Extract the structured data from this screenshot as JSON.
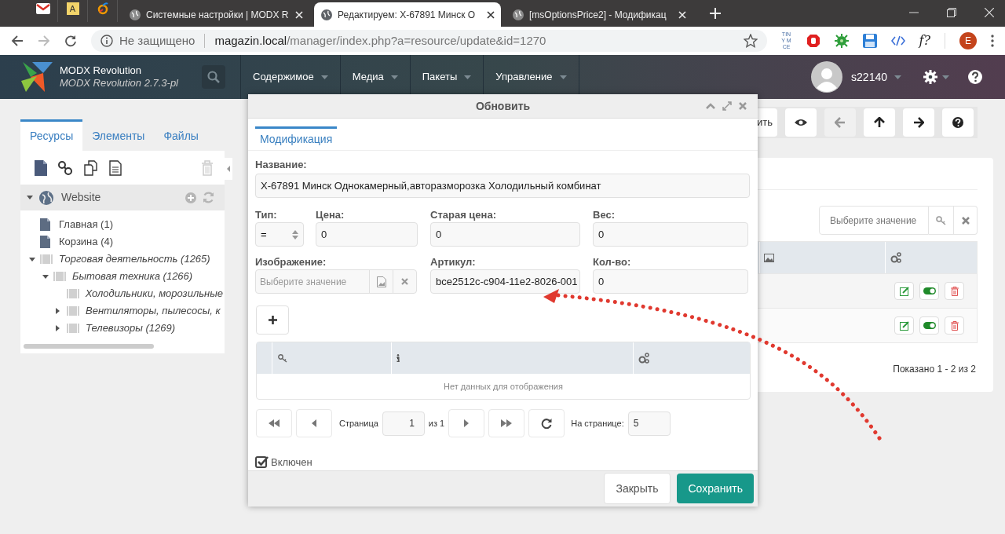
{
  "browser": {
    "pinned_tabs": [
      {
        "kind": "mail"
      },
      {
        "kind": "letter",
        "label": "A"
      },
      {
        "kind": "swirl"
      }
    ],
    "tabs": [
      {
        "title": "Системные настройки | MODX R",
        "selected": false
      },
      {
        "title": "Редактируем: X-67891 Минск О",
        "selected": true
      },
      {
        "title": "[msOptionsPrice2] - Модификац",
        "selected": false
      }
    ],
    "security": "Не защищено",
    "url_host": "magazin.local",
    "url_path": "/manager/index.php?a=resource/update&id=1270",
    "extensions": [
      {
        "kind": "tinymce",
        "label": "TINY MCE"
      },
      {
        "kind": "stop"
      },
      {
        "kind": "bug"
      },
      {
        "kind": "save"
      },
      {
        "kind": "code"
      },
      {
        "kind": "text",
        "label": "f?"
      }
    ],
    "profile": "E"
  },
  "header": {
    "brand": "MODX Revolution",
    "version": "MODX Revolution 2.7.3-pl",
    "menu": [
      "Содержимое",
      "Медиа",
      "Пакеты",
      "Управление"
    ],
    "user": "s22140"
  },
  "sidebar": {
    "tabs": [
      {
        "label": "Ресурсы",
        "selected": true
      },
      {
        "label": "Элементы",
        "selected": false
      },
      {
        "label": "Файлы",
        "selected": false
      }
    ],
    "root": "Website",
    "tree": [
      {
        "label": "Главная (1)",
        "kind": "document"
      },
      {
        "label": "Корзина (4)",
        "kind": "document"
      },
      {
        "label": "Торговая деятельность (1265)",
        "kind": "category",
        "expanded": true,
        "children": [
          {
            "label": "Бытовая техника (1266)",
            "kind": "category",
            "expanded": true,
            "children": [
              {
                "label": "Холодильники, морозильные",
                "kind": "category"
              },
              {
                "label": "Вентиляторы, пылесосы, к",
                "kind": "category",
                "expanded": false
              },
              {
                "label": "Телевизоры (1269)",
                "kind": "category",
                "expanded": false
              }
            ]
          }
        ]
      }
    ]
  },
  "toolbar": [
    {
      "kind": "text",
      "label": "ить",
      "disabled": false
    },
    {
      "kind": "eye",
      "disabled": false
    },
    {
      "kind": "left",
      "disabled": true
    },
    {
      "kind": "up",
      "disabled": false
    },
    {
      "kind": "right",
      "disabled": false
    },
    {
      "kind": "help",
      "disabled": false
    }
  ],
  "options_grid": {
    "filter_placeholder": "Выберите значение",
    "rows": [
      {
        "enabled": true
      },
      {
        "enabled": true
      }
    ],
    "footer": "Показано 1 - 2 из 2"
  },
  "dialog": {
    "title": "Обновить",
    "tabs": [
      {
        "label": "Модификация",
        "selected": true
      }
    ],
    "name_label": "Название:",
    "name_value": "X-67891 Минск Однокамерный,авторазморозка Холодильный комбинат",
    "type_label": "Тип:",
    "type_value": "=",
    "price_label": "Цена:",
    "price_value": "0",
    "old_price_label": "Старая цена:",
    "old_price_value": "0",
    "weight_label": "Вес:",
    "weight_value": "0",
    "image_label": "Изображение:",
    "image_placeholder": "Выберите значение",
    "article_label": "Артикул:",
    "article_value": "bce2512c-c904-11e2-8026-001",
    "count_label": "Кол-во:",
    "count_value": "0",
    "grid_empty": "Нет данных для отображения",
    "pager": {
      "page_label": "Страница",
      "page": "1",
      "of": "из 1",
      "per_page_label": "На странице:",
      "per_page": "5"
    },
    "enabled_label": "Включен",
    "enabled": true,
    "buttons": [
      {
        "label": "Закрыть",
        "kind": "secondary"
      },
      {
        "label": "Сохранить",
        "kind": "primary"
      }
    ]
  }
}
